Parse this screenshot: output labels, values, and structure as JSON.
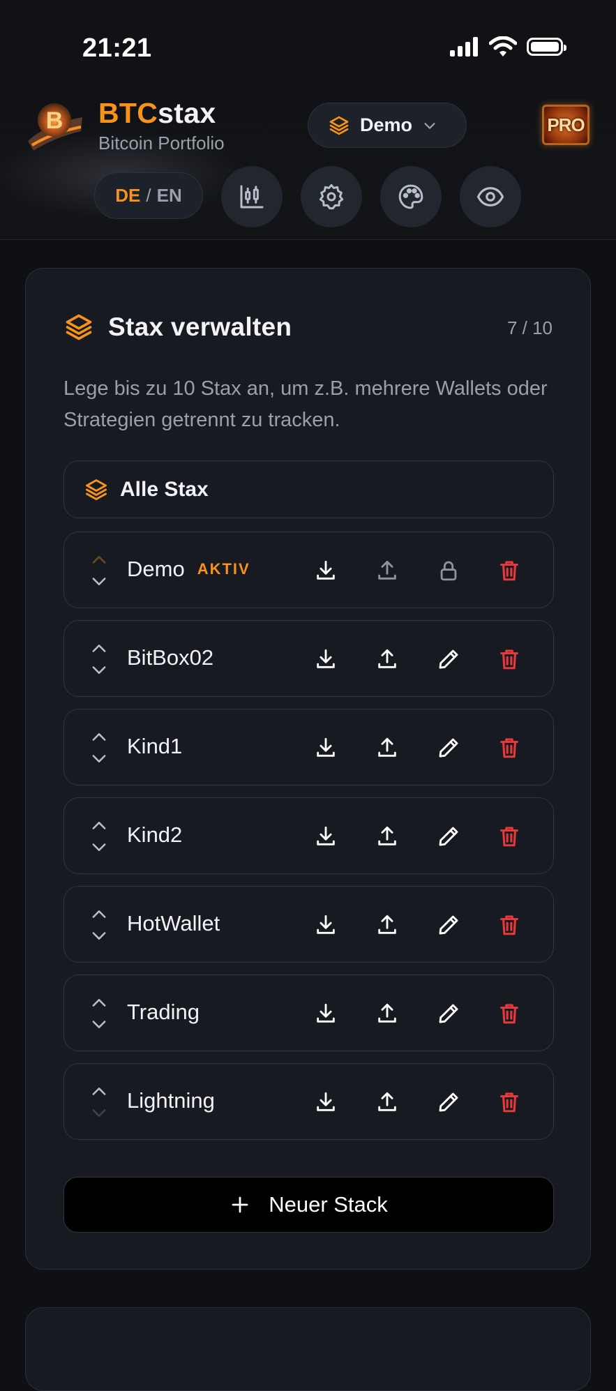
{
  "status_bar": {
    "time": "21:21"
  },
  "header": {
    "brand_accent": "BTC",
    "brand_rest": "stax",
    "subtitle": "Bitcoin Portfolio",
    "stack_selector": "Demo",
    "pro_badge": "PRO",
    "lang": {
      "de": "DE",
      "separator": "/",
      "en": "EN"
    },
    "buttons": [
      "chart-icon",
      "gear-icon",
      "palette-icon",
      "eye-icon"
    ]
  },
  "manage": {
    "title": "Stax verwalten",
    "count": "7 / 10",
    "description": "Lege bis zu 10 Stax an, um z.B. mehrere Wallets oder Strategien getrennt zu tracken.",
    "all_label": "Alle Stax",
    "stacks": [
      {
        "name": "Demo",
        "badge": "AKTIV",
        "locked": true
      },
      {
        "name": "BitBox02",
        "badge": "",
        "locked": false
      },
      {
        "name": "Kind1",
        "badge": "",
        "locked": false
      },
      {
        "name": "Kind2",
        "badge": "",
        "locked": false
      },
      {
        "name": "HotWallet",
        "badge": "",
        "locked": false
      },
      {
        "name": "Trading",
        "badge": "",
        "locked": false
      },
      {
        "name": "Lightning",
        "badge": "",
        "locked": false
      }
    ],
    "new_stack_label": "Neuer Stack"
  },
  "colors": {
    "accent": "#f7931a",
    "danger": "#e5393b",
    "background": "#0e1014",
    "card": "#171a20"
  }
}
